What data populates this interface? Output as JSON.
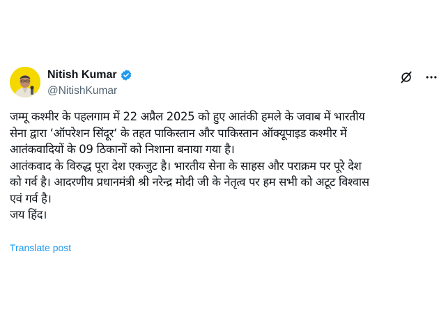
{
  "author": {
    "display_name": "Nitish Kumar",
    "handle": "@NitishKumar",
    "verified": true
  },
  "icons": {
    "verified": "verified-badge-icon",
    "grok": "grok-icon",
    "more": "more-options-icon"
  },
  "colors": {
    "accent": "#1d9bf0",
    "text": "#0f1419",
    "secondary_text": "#536471",
    "avatar_bg": "#f5d800"
  },
  "post": {
    "lines": [
      "जम्मू कश्मीर के पहलगाम में 22 अप्रैल 2025 को हुए आतंकी हमले के जवाब में भारतीय",
      "सेना द्वारा ‘ऑपरेशन सिंदूर‘ के तहत पाकिस्तान और पाकिस्तान ऑक्यूपाइड कश्मीर में",
      "आतंकवादियों के 09 ठिकानों को निशाना बनाया गया है।",
      "आतंकवाद के विरुद्ध पूरा देश एकजुट है। भारतीय सेना के साहस और पराक्रम पर पूरे देश",
      "को गर्व है। आदरणीय प्रधानमंत्री श्री नरेन्द्र मोदी जी के नेतृत्व पर हम सभी को अटूट विश्वास",
      "एवं गर्व है।",
      "जय हिंद।"
    ],
    "translate_label": "Translate post"
  }
}
